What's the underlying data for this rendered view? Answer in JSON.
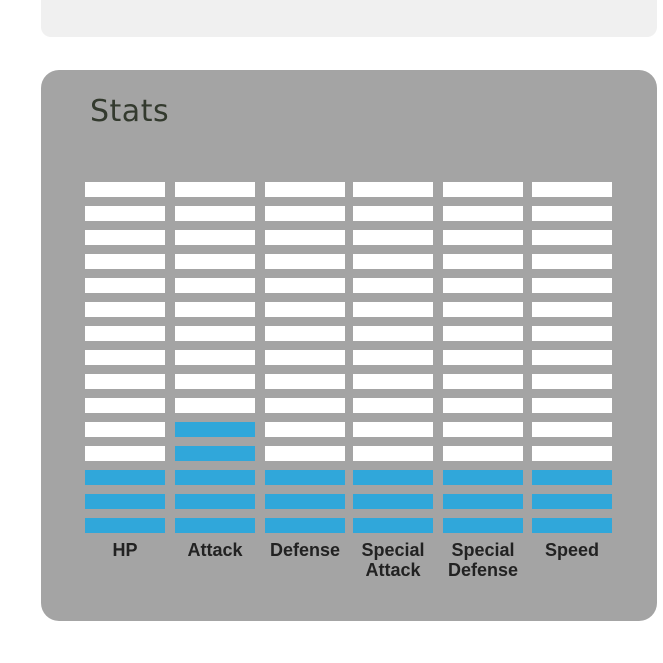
{
  "title": "Stats",
  "max_segments": 15,
  "colors": {
    "filled": "#30a7da",
    "empty": "#ffffff",
    "card": "#a4a4a4"
  },
  "stats": [
    {
      "label": "HP",
      "value": 3
    },
    {
      "label": "Attack",
      "value": 5
    },
    {
      "label": "Defense",
      "value": 3
    },
    {
      "label": "Special Attack",
      "value": 3
    },
    {
      "label": "Special Defense",
      "value": 3
    },
    {
      "label": "Speed",
      "value": 3
    }
  ]
}
